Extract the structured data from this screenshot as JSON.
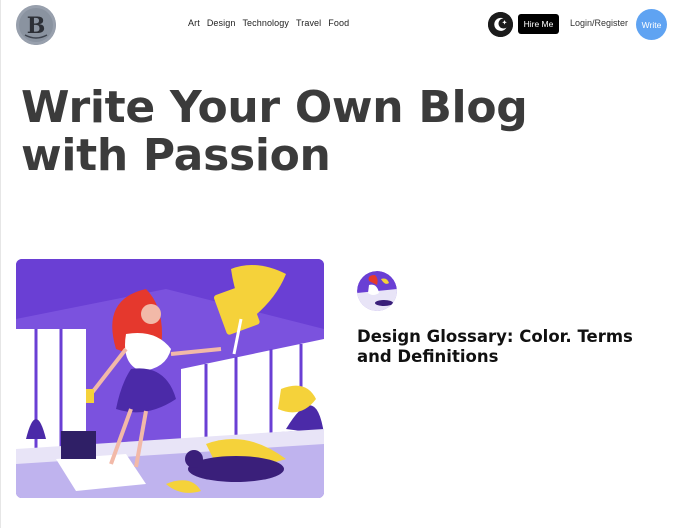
{
  "header": {
    "logo_icon": "blog-logo-icon",
    "nav": [
      "Art",
      "Design",
      "Technology",
      "Travel",
      "Food"
    ],
    "theme_toggle_icon": "moon-icon",
    "hire_label": "Hire Me",
    "login_label": "Login/Register",
    "write_label": "Write"
  },
  "hero": {
    "title": "Write Your Own Blog with Passion"
  },
  "featured": {
    "image_icon": "illustration-woman-painting",
    "thumb_icon": "post-thumbnail-icon",
    "title": "Design Glossary: Color. Terms and Definitions"
  },
  "colors": {
    "accent_purple": "#6a3fd4",
    "write_button": "#5fa3f2",
    "yellow": "#f5d23a",
    "red_hair": "#e5382d"
  }
}
